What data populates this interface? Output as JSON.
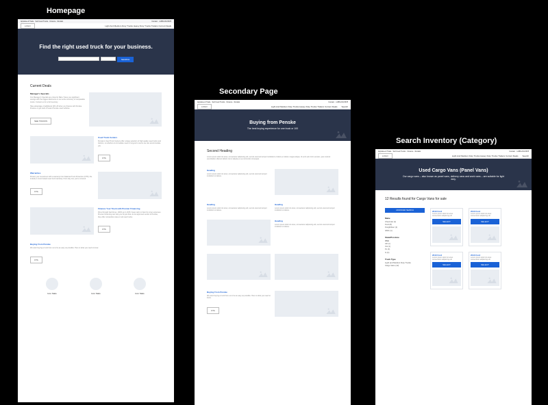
{
  "labels": {
    "homepage": "Homepage",
    "secondary": "Secondary Page",
    "search": "Search Inventory (Category)"
  },
  "common": {
    "logo": "LOGO",
    "topbar_left": "Appraise & Trade · Sell Used Trucks · Finance · Rentals",
    "topbar_right": "Contact · 1-888-234-5678",
    "nav_items": "Light And Medium Duty Trucks     Heavy Duty Trucks     Trailers     Current Deals",
    "search_link": "Search"
  },
  "homepage": {
    "hero_title": "Find the right used truck for your business.",
    "search_btn": "SEARCH",
    "deals_h": "Current Deals",
    "deals_sub": "Manager's Specials",
    "deals_body": "Our Manager's Specials are priced to SELL! Save you significant savings with the biggest discounts on our entire inventory of comparable trucks. Contact us for a full inventory.",
    "deals_body2": "Take advantage of additional 10% off when you finance with Penske Finance or get cash off select Penske used vehicles.",
    "btn_view": "SEE TRUCKS",
    "item1_h": "Used Truck Centers",
    "item1_b": "Penske's Used Truck Centers offer a large selection of high quality used trucks and tractors, so whether an immediate need or long-term source we can accommodate you.",
    "item2_h": "Warranties",
    "item2_b": "Protect your investment with a warranty from National Truck Protection (NTP), the industry's most trusted used truck warranty. From day one you're covered.",
    "item3_h": "Finance Your Truck with Premier Financing",
    "item3_b": "Drive through hard times. 100% go in 2015. Keep cash on hand to cover expenses. Premier Financing can help you do just that. As an approved vendor of Penske, they offer competitive rates on all used trucks.",
    "item4_h": "Buying From Penske",
    "item4_b": "We want buying a truck from us to be as easy as possible. Here is what you need to know.",
    "cta": "CTA",
    "icon_label": "Icon Stats"
  },
  "secondary": {
    "hero_title": "Buying from Penske",
    "hero_sub": "The best buying experience for one truck or 100",
    "h2": "Second Heading",
    "body": "Lorem ipsum dolor sit amet, consectetur adipiscing elit, sed do eiusmod tempor incididunt ut labore et dolore magna aliqua. Ut enim ad minim veniam, quis nostrud exercitation ullamco laboris nisi ut aliquip ex ea commodo consequat.",
    "sub_h": "Heading",
    "sub_b": "Lorem ipsum dolor sit amet, consectetur adipiscing elit, sed do eiusmod tempor incididunt ut labore.",
    "cta_h": "Buying From Penske",
    "cta_b": "We want buying a truck from us to be as easy as possible. Here is what you need to know."
  },
  "search": {
    "hero_title": "Used Cargo Vans (Panel Vans)",
    "hero_sub": "Our cargo vans – also known as panel vans, delivery vans and work vans – are suitable for light duty.",
    "results_h": "12 Results found for Cargo Vans for sale",
    "adv": "ADVANCED SEARCH",
    "f1_h": "Make",
    "f1_items": [
      "Chevrolet (1)",
      "Ford (8)",
      "Freightliner (1)",
      "GMC (1)"
    ],
    "f2_h": "State/Province",
    "f2_sub": "USA",
    "f2_items": [
      "AZ (1)",
      "CA (1)",
      "FL (1)",
      "IL (1)"
    ],
    "f3_h": "Truck Type",
    "f3_items": [
      "Light and Medium Duty Trucks",
      "Cargo Vans (12)"
    ],
    "card_title": "2010 Ford",
    "card_body": "Lorem ipsum dolor sit amet consectetur adipiscing elit",
    "select": "SELECT"
  }
}
